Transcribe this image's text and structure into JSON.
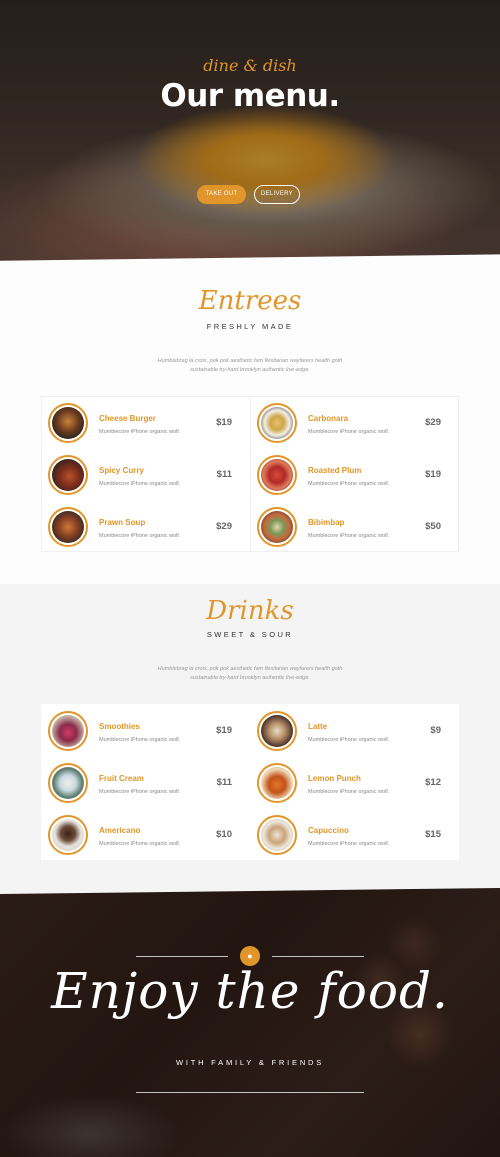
{
  "hero": {
    "script": "dine & dish",
    "title": "Our menu.",
    "buttons": {
      "takeout": "TAKE OUT",
      "delivery": "DELIVERY"
    }
  },
  "entrees": {
    "title": "Entrees",
    "subtitle": "FRESHLY MADE",
    "intro": "Humblebrag la croix, pok pok aesthetic fam flexitarian wayfarers health goth sustainable try-hard brooklyn authentic live-edge.",
    "items": [
      {
        "name": "Cheese Burger",
        "desc": "Mumblecore iPhone organic wolf.",
        "price": "$19"
      },
      {
        "name": "Carbonara",
        "desc": "Mumblecore iPhone organic wolf.",
        "price": "$29"
      },
      {
        "name": "Spicy Curry",
        "desc": "Mumblecore iPhone organic wolf.",
        "price": "$11"
      },
      {
        "name": "Roasted Plum",
        "desc": "Mumblecore iPhone organic wolf.",
        "price": "$19"
      },
      {
        "name": "Prawn Soup",
        "desc": "Mumblecore iPhone organic wolf.",
        "price": "$29"
      },
      {
        "name": "Bibimbap",
        "desc": "Mumblecore iPhone organic wolf.",
        "price": "$50"
      }
    ]
  },
  "drinks": {
    "title": "Drinks",
    "subtitle": "SWEET & SOUR",
    "intro": "Humblebrag la croix, pok pok aesthetic fam flexitarian wayfarers health goth sustainable try-hard brooklyn authentic live-edge.",
    "items": [
      {
        "name": "Smoothies",
        "desc": "Mumblecore iPhone organic wolf.",
        "price": "$19"
      },
      {
        "name": "Latte",
        "desc": "Mumblecore iPhone organic wolf.",
        "price": "$9"
      },
      {
        "name": "Fruit Cream",
        "desc": "Mumblecore iPhone organic wolf.",
        "price": "$11"
      },
      {
        "name": "Lemon Punch",
        "desc": "Mumblecore iPhone organic wolf.",
        "price": "$12"
      },
      {
        "name": "Americano",
        "desc": "Mumblecore iPhone organic wolf.",
        "price": "$10"
      },
      {
        "name": "Capuccino",
        "desc": "Mumblecore iPhone organic wolf.",
        "price": "$15"
      }
    ]
  },
  "footer": {
    "script": "Enjoy the food.",
    "subtitle": "WITH FAMILY & FRIENDS",
    "badge_icon": "flame-icon"
  },
  "colors": {
    "accent": "#e0962a",
    "text_dark": "#333333",
    "text_muted": "#888888"
  }
}
